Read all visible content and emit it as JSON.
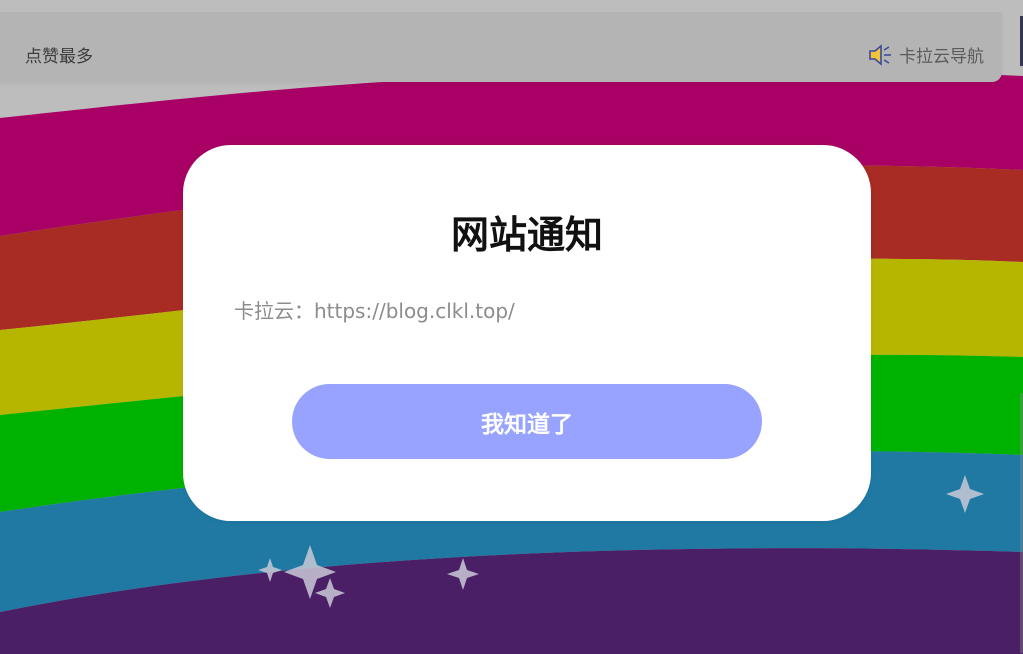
{
  "topbar": {
    "left_text": "点赞最多",
    "right_text": "卡拉云导航",
    "right_icon": "speaker-icon"
  },
  "modal": {
    "title": "网站通知",
    "body": "卡拉云：https://blog.clkl.top/",
    "button_label": "我知道了"
  },
  "colors": {
    "stripe_magenta": "#a80064",
    "stripe_red": "#a82b24",
    "stripe_yellow": "#b6b600",
    "stripe_green": "#00b200",
    "stripe_blue": "#1f79a3",
    "stripe_purple": "#4a1f66",
    "button": "#98a3ff",
    "modal_bg": "#ffffff"
  }
}
